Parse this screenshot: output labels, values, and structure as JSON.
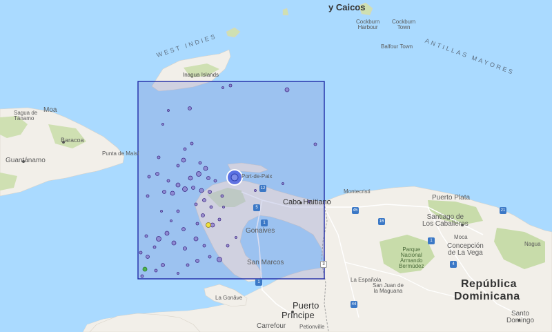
{
  "map": {
    "labels": {
      "turks_caicos": "y Caicos",
      "west_indies": "WEST INDIES",
      "antillas": "ANTILLAS MAYORES",
      "inagua": "Inagua Islands",
      "cockburn_harbour": "Cockburn\nHarbour",
      "cockburn_town": "Cockburn\nTown",
      "balfour_town": "Balfour Town",
      "moa": "Moa",
      "sagua": "Sagua de\nTánamo",
      "baracoa": "Baracoa",
      "guantanamo": "Guantánamo",
      "punta_maisi": "Punta de Maisí",
      "port_de_paix": "Port-de-Paix",
      "cabo_haitiano": "Cabo Haitiano",
      "gonaives": "Gonaives",
      "san_marcos": "San Marcos",
      "puerto_plata": "Puerto Plata",
      "santiago": "Santiago de\nLos Caballeros",
      "moca": "Moca",
      "concepcion": "Concepción\nde La Vega",
      "nagua": "Nagua",
      "parque": "Parque\nNacional\nArmando\nBermúdez",
      "la_espanola": "La Española",
      "san_juan": "San Juan de\nla Maguana",
      "republica_1": "República",
      "republica_2": "Dominicana",
      "puerto_principe_1": "Puerto",
      "puerto_principe_2": "Príncipe",
      "carrefour": "Carrefour",
      "petionville": "Petionville",
      "la_gonave": "La Gonâve",
      "santo_domingo": "Santo\nDomingo",
      "montecristi": "Montecristi"
    },
    "colors": {
      "water": "#aadaff",
      "land": "#f2efe9",
      "forest": "#c8dcaa",
      "selection_fill": "#7b86c8",
      "selection_stroke": "#1e2aa6",
      "quake_fill": "#8a78c8",
      "quake_stroke": "#3f2a86",
      "large_quake": "#4f63e0",
      "yellow_marker": "#f0e040",
      "green_marker": "#4fb24f"
    }
  }
}
